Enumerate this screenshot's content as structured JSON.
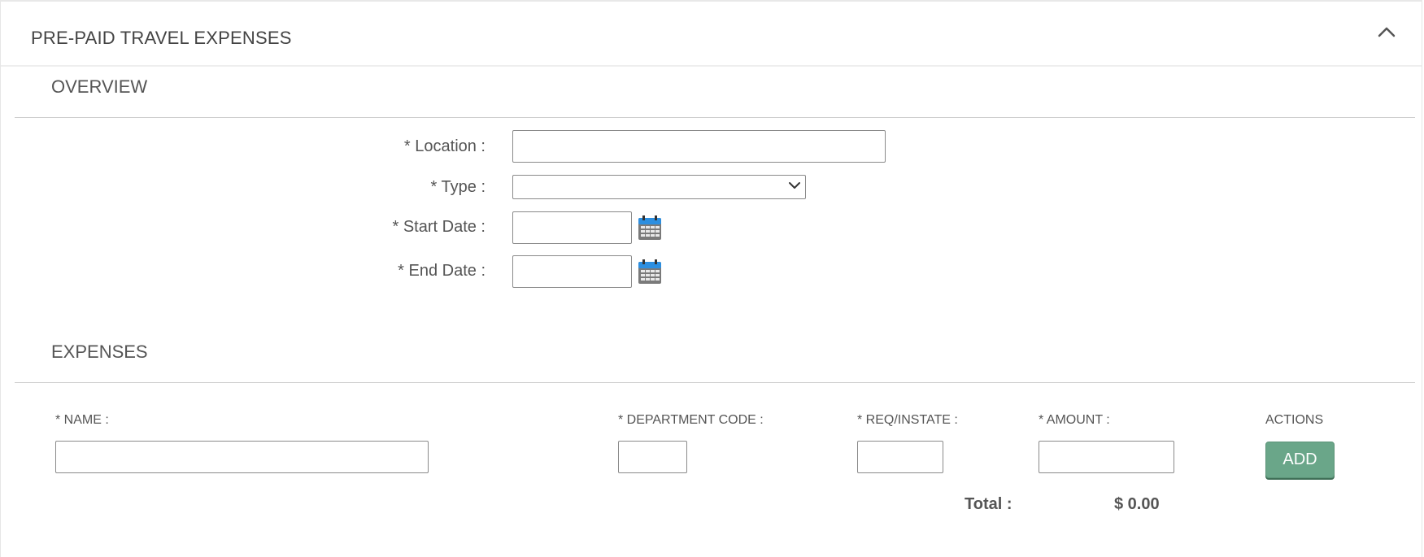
{
  "panel": {
    "title": "PRE-PAID TRAVEL EXPENSES",
    "collapse_icon": "chevron-up-icon"
  },
  "overview": {
    "heading": "OVERVIEW",
    "location_label": "* Location :",
    "location_value": "",
    "type_label": "* Type :",
    "type_selected": "",
    "start_date_label": "* Start Date :",
    "start_date_value": "",
    "end_date_label": "* End Date :",
    "end_date_value": "",
    "calendar_icon": "calendar-icon"
  },
  "expenses": {
    "heading": "EXPENSES",
    "columns": {
      "name": "* NAME :",
      "department_code": "* DEPARTMENT CODE :",
      "req_instate": "* REQ/INSTATE :",
      "amount": "* AMOUNT :",
      "actions": "ACTIONS"
    },
    "row": {
      "name": "",
      "department_code": "",
      "req_instate": "",
      "amount": ""
    },
    "add_label": "ADD",
    "total_label": "Total :",
    "total_value": "$ 0.00"
  },
  "colors": {
    "add_button": "#6aa689",
    "calendar_header": "#2d8fe0"
  }
}
